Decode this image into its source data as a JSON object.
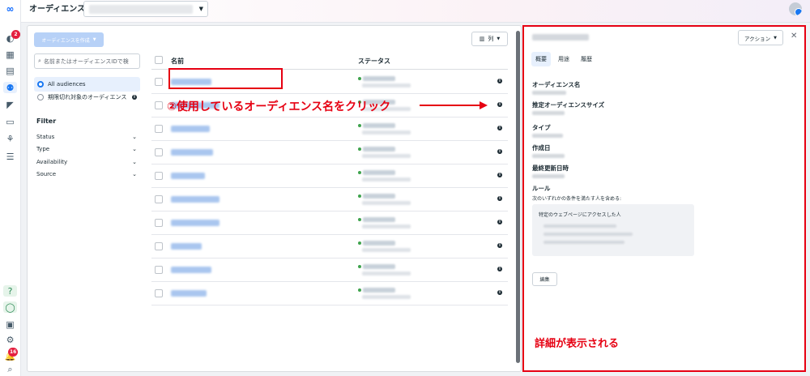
{
  "header": {
    "title": "オーディエンス"
  },
  "rail": {
    "notification_badge": "2",
    "alert_badge": "16"
  },
  "toolbar": {
    "create_label": "オーディエンスを作成",
    "columns_label": "列"
  },
  "sidebar": {
    "search_placeholder": "名前またはオーディエンスIDで検",
    "options": [
      {
        "label": "All audiences",
        "selected": true
      },
      {
        "label": "期限切れ対象のオーディエンス",
        "selected": false
      }
    ],
    "filter_title": "Filter",
    "filters": [
      "Status",
      "Type",
      "Availability",
      "Source"
    ]
  },
  "table": {
    "col_name": "名前",
    "col_status": "ステータス",
    "row_count": 10
  },
  "panel": {
    "action_label": "アクション",
    "tabs": [
      "概要",
      "用途",
      "履歴"
    ],
    "fields": {
      "audience_name": "オーディエンス名",
      "estimated_size": "推定オーディエンスサイズ",
      "type": "タイプ",
      "created": "作成日",
      "last_updated": "最終更新日時",
      "rule": "ルール"
    },
    "rule_condition": "次のいずれかの条件を満たす人を含める:",
    "rule_box_title": "特定のウェブページにアクセスした人",
    "edit_label": "編集"
  },
  "annotations": {
    "step_text": "②使用しているオーディエンス名をクリック",
    "detail_text": "詳細が表示される",
    "color": "#e60012"
  }
}
